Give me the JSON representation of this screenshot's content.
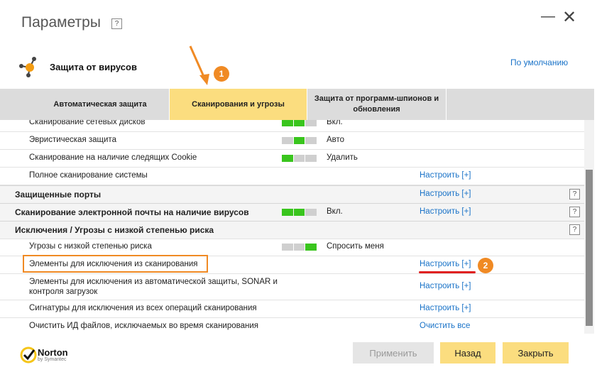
{
  "window": {
    "title": "Параметры",
    "help": "?",
    "minimize_icon": "minimize-icon",
    "close_icon": "close-icon"
  },
  "section": {
    "title": "Защита от вирусов",
    "default_link": "По умолчанию",
    "icon": "virus-protection-icon"
  },
  "tabs": [
    {
      "label": "Автоматическая защита"
    },
    {
      "label": "Сканирования и угрозы",
      "active": true
    },
    {
      "label": "Защита от программ-шпионов и обновления"
    }
  ],
  "rows": {
    "network": {
      "label": "Сканирование сетевых дисков",
      "value": "Вкл."
    },
    "heuristic": {
      "label": "Эвристическая защита",
      "value": "Авто"
    },
    "cookies": {
      "label": "Сканирование на наличие следящих Cookie",
      "value": "Удалить"
    },
    "fullscan": {
      "label": "Полное сканирование системы",
      "action": "Настроить [+]"
    },
    "ports": {
      "label": "Защищенные порты",
      "action": "Настроить [+]",
      "help": "?"
    },
    "email": {
      "label": "Сканирование электронной почты на наличие вирусов",
      "value": "Вкл.",
      "action": "Настроить [+]",
      "help": "?"
    },
    "exclusions": {
      "label": "Исключения / Угрозы с низкой степенью риска",
      "help": "?"
    },
    "lowrisk": {
      "label": "Угрозы с низкой степенью риска",
      "value": "Спросить меня"
    },
    "scan_excl": {
      "label": "Элементы для исключения из сканирования",
      "action": "Настроить [+]"
    },
    "auto_excl": {
      "label": "Элементы для исключения из автоматической защиты, SONAR и контроля загрузок",
      "action": "Настроить [+]"
    },
    "sig_excl": {
      "label": "Сигнатуры для исключения из всех операций сканирования",
      "action": "Настроить [+]"
    },
    "clear_ids": {
      "label": "Очистить ИД файлов, исключаемых во время сканирования",
      "action": "Очистить все"
    }
  },
  "annotations": {
    "badge1": "1",
    "badge2": "2",
    "accent": "#f08a24"
  },
  "buttons": {
    "apply": "Применить",
    "back": "Назад",
    "close": "Закрыть"
  },
  "logo": {
    "name": "Norton",
    "sub": "by Symantec"
  },
  "colors": {
    "tab_active": "#fbdd7f",
    "toggle_on": "#39c51d",
    "link": "#1a73c8"
  }
}
